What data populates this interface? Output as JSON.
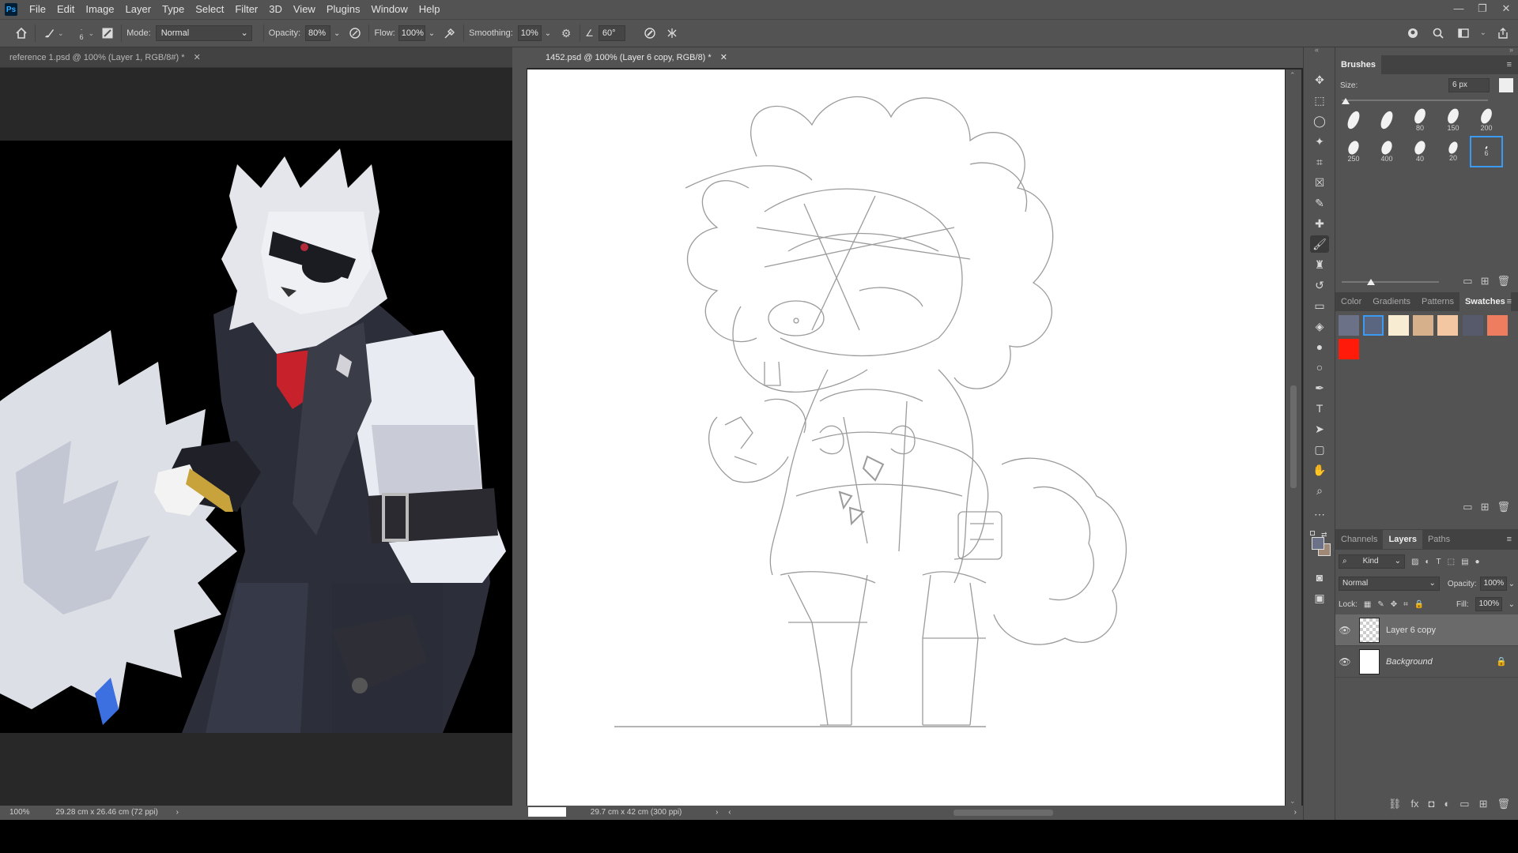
{
  "app": {
    "logo": "Ps"
  },
  "menu": [
    "File",
    "Edit",
    "Image",
    "Layer",
    "Type",
    "Select",
    "Filter",
    "3D",
    "View",
    "Plugins",
    "Window",
    "Help"
  ],
  "window_controls": {
    "minimize": "—",
    "restore": "❐",
    "close": "✕"
  },
  "options": {
    "brush_size": "6",
    "mode_label": "Mode:",
    "mode_value": "Normal",
    "opacity_label": "Opacity:",
    "opacity_value": "80%",
    "flow_label": "Flow:",
    "flow_value": "100%",
    "smoothing_label": "Smoothing:",
    "smoothing_value": "10%",
    "angle_value": "60°"
  },
  "docs": {
    "left_tab": "reference 1.psd @ 100% (Layer 1, RGB/8#) *",
    "left_zoom": "100%",
    "left_size": "29.28 cm x 26.46 cm (72 ppi)",
    "right_tab": "1452.psd @ 100% (Layer 6 copy, RGB/8) *",
    "right_size": "29.7 cm x 42 cm (300 ppi)"
  },
  "brushes": {
    "title": "Brushes",
    "size_label": "Size:",
    "size_value": "6 px",
    "presets": [
      {
        "label": ""
      },
      {
        "label": ""
      },
      {
        "label": "80"
      },
      {
        "label": "150"
      },
      {
        "label": "200"
      },
      {
        "label": "250"
      },
      {
        "label": "400"
      },
      {
        "label": "40"
      },
      {
        "label": "20"
      },
      {
        "label": "6"
      }
    ]
  },
  "swatches_panel": {
    "tabs": [
      "Color",
      "Gradients",
      "Patterns",
      "Swatches"
    ],
    "active": "Swatches",
    "colors": [
      "#6b7186",
      "#5a6680",
      "#f8ecd3",
      "#d6b08a",
      "#f2c7a2",
      "#575a6b",
      "#ee7c5e",
      "#ff1a0a"
    ]
  },
  "layers_panel": {
    "tabs": [
      "Channels",
      "Layers",
      "Paths"
    ],
    "active": "Layers",
    "filter_label": "Kind",
    "blend_mode": "Normal",
    "opacity_label": "Opacity:",
    "opacity_value": "100%",
    "lock_label": "Lock:",
    "fill_label": "Fill:",
    "fill_value": "100%",
    "layers": [
      {
        "name": "Layer 6 copy",
        "selected": true
      },
      {
        "name": "Background",
        "selected": false
      }
    ]
  }
}
